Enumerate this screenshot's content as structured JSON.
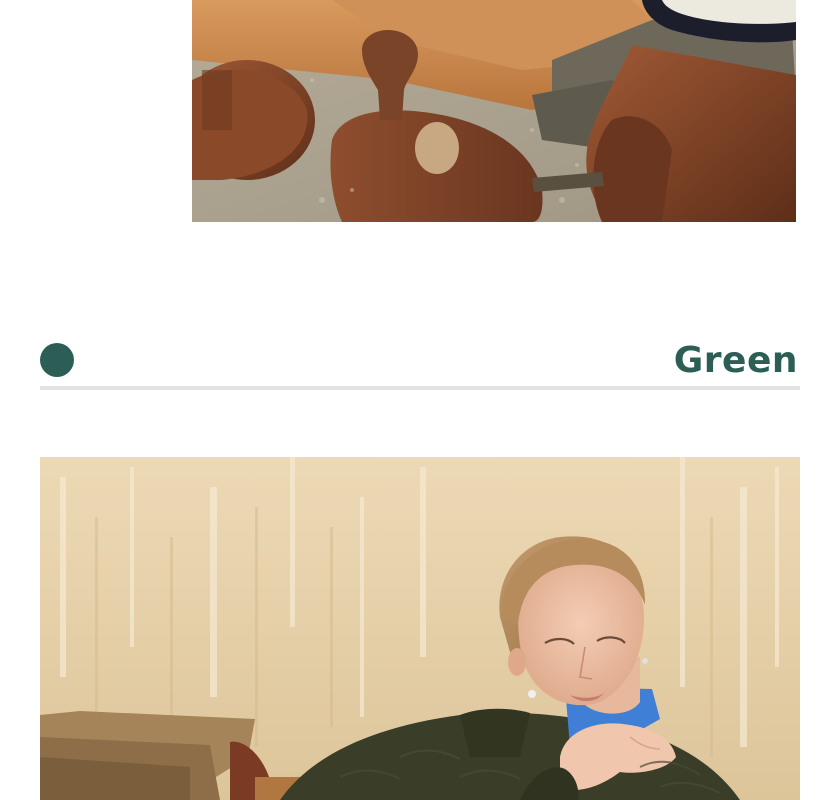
{
  "color_section": {
    "name": "Green",
    "swatch_color": "#2d5e55",
    "title_color": "#2d5e55",
    "divider_color": "#e2e2e2"
  },
  "images": {
    "top": {
      "subject": "leather-and-suede-shoe-lasts",
      "palette": [
        "#c98a4e",
        "#8a4a2a",
        "#6a6456",
        "#b8b0a0"
      ]
    },
    "model": {
      "subject": "model-in-dark-green-knit-sweater",
      "palette": [
        "#e9d4ad",
        "#3a3d28",
        "#3f7fd6",
        "#a5845a"
      ]
    }
  }
}
